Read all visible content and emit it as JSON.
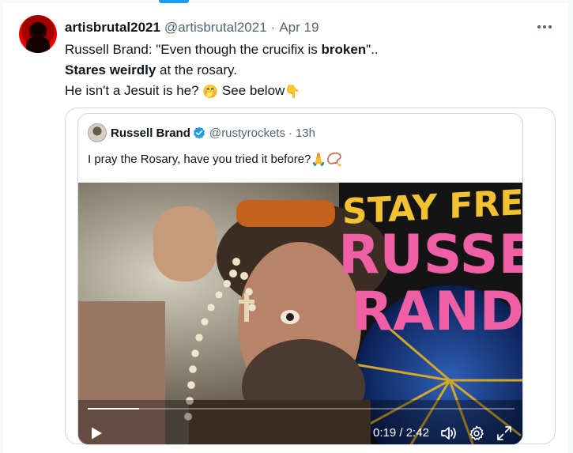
{
  "tweet": {
    "display_name": "artisbrutal2021",
    "handle": "@artisbrutal2021",
    "separator": "·",
    "date": "Apr 19",
    "lines": [
      {
        "text": "Russell Brand: \"Even though the crucifix is "
      },
      {
        "bold": "broken"
      },
      {
        "text": "\".."
      },
      {
        "bold": "Stares weirdly"
      },
      {
        "text": " at the rosary."
      },
      {
        "text": "He isn't a Jesuit is he? "
      },
      {
        "text": " See below"
      }
    ],
    "emoji": {
      "shh": "🤭",
      "point_down": "👇"
    }
  },
  "quote": {
    "display_name": "Russell Brand",
    "handle": "@rustyrockets",
    "separator": "·",
    "time": "13h",
    "text": "I pray the Rosary, have you tried it before?",
    "emoji": {
      "pray": "🙏",
      "rosary": "📿"
    },
    "video": {
      "promo_top": "STAY FREE",
      "promo_mid": "RUSSEL",
      "promo_bot": "RAND",
      "time_elapsed": "0:19",
      "time_sep": " / ",
      "time_total": "2:42",
      "progress": 0.12
    }
  },
  "colors": {
    "text": "#0f1419",
    "secondary": "#536471",
    "border": "#cfd9de",
    "verified": "#1d9bf0",
    "promo_yellow": "#f2c230",
    "promo_pink": "#ef5fa6"
  }
}
